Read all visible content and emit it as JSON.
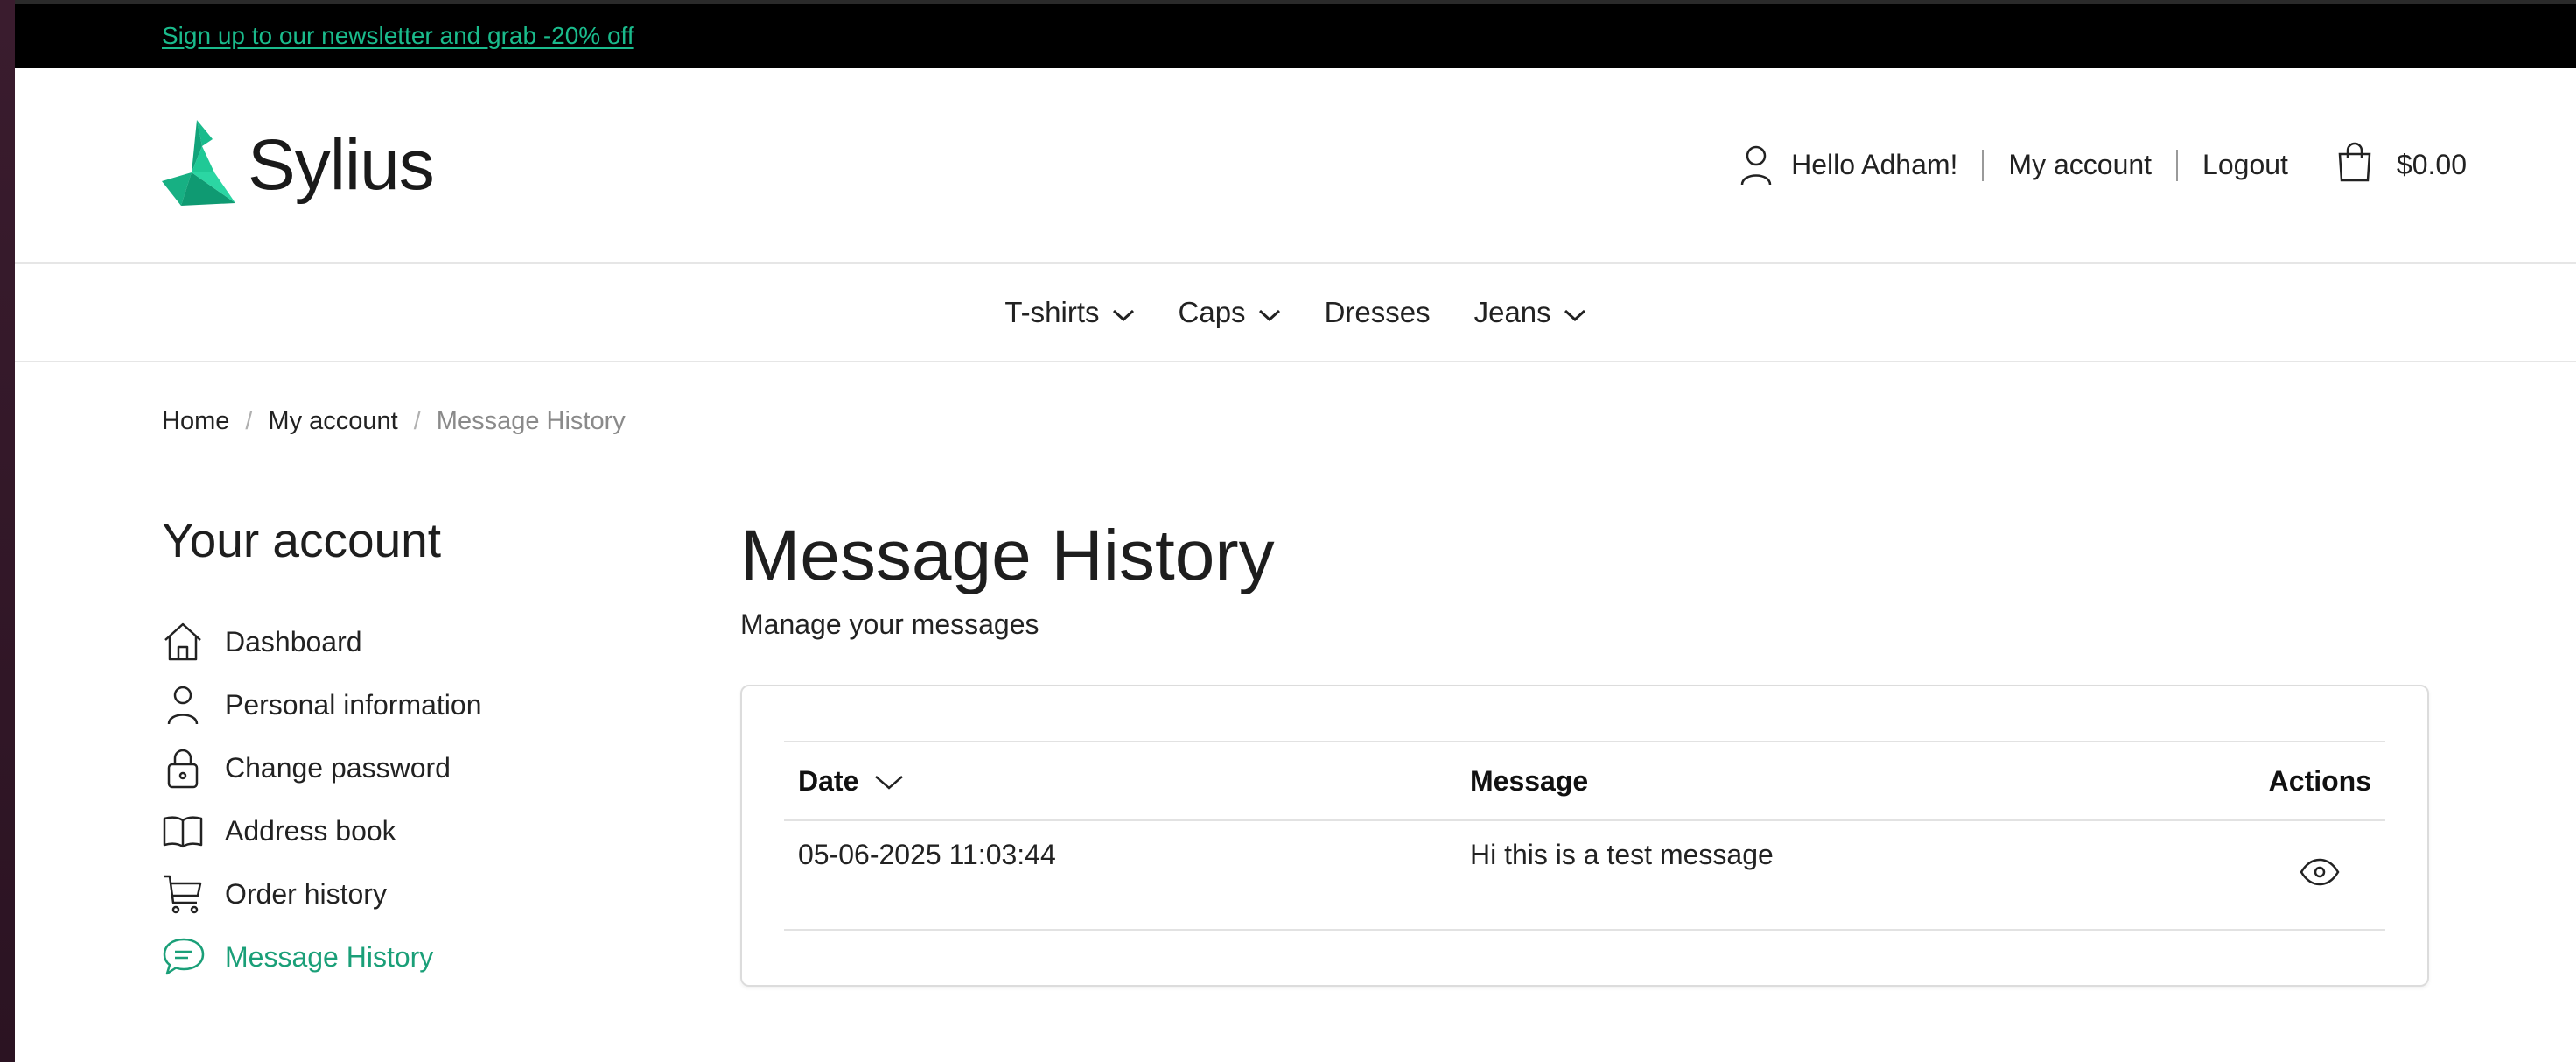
{
  "topbar": {
    "newsletter_link": "Sign up to our newsletter and grab -20% off"
  },
  "header": {
    "brand": "Sylius",
    "greeting": "Hello Adham!",
    "my_account": "My account",
    "logout": "Logout",
    "cart_total": "$0.00",
    "accent_color": "#1abb8c"
  },
  "nav": {
    "items": [
      {
        "label": "T-shirts",
        "has_dropdown": true
      },
      {
        "label": "Caps",
        "has_dropdown": true
      },
      {
        "label": "Dresses",
        "has_dropdown": false
      },
      {
        "label": "Jeans",
        "has_dropdown": true
      }
    ]
  },
  "breadcrumb": {
    "home": "Home",
    "my_account": "My account",
    "current": "Message History"
  },
  "sidebar": {
    "title": "Your account",
    "items": [
      {
        "label": "Dashboard",
        "icon": "home-icon"
      },
      {
        "label": "Personal information",
        "icon": "user-icon"
      },
      {
        "label": "Change password",
        "icon": "lock-icon"
      },
      {
        "label": "Address book",
        "icon": "book-icon"
      },
      {
        "label": "Order history",
        "icon": "cart-icon"
      },
      {
        "label": "Message History",
        "icon": "message-icon",
        "active": true
      }
    ]
  },
  "main": {
    "title": "Message History",
    "subtitle": "Manage your messages",
    "table": {
      "headers": {
        "date": "Date",
        "message": "Message",
        "actions": "Actions"
      },
      "rows": [
        {
          "date": "05-06-2025 11:03:44",
          "message": "Hi this is a test message",
          "action_icon": "eye-icon"
        }
      ]
    }
  }
}
